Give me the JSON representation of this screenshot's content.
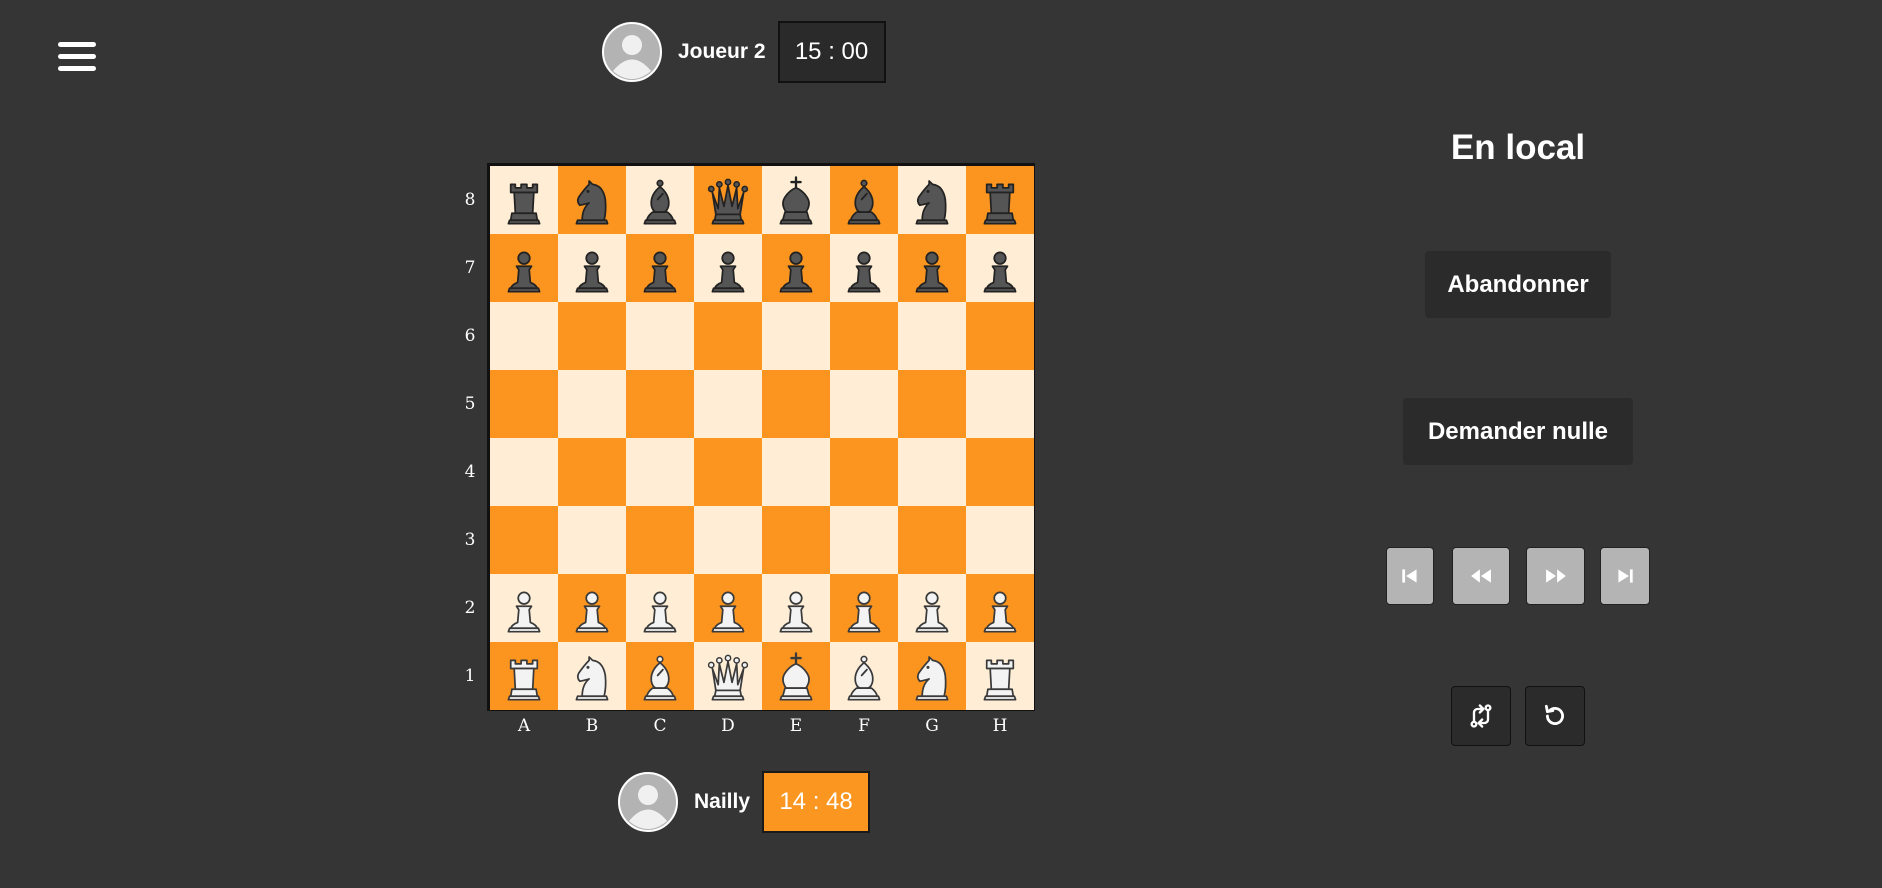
{
  "menu": {
    "icon": "hamburger-menu-icon"
  },
  "players": {
    "top": {
      "name": "Joueur 2",
      "clock": "15 : 00",
      "avatar_icon": "user-avatar-icon"
    },
    "bottom": {
      "name": "Nailly",
      "clock": "14 : 48",
      "avatar_icon": "user-avatar-icon"
    }
  },
  "board": {
    "ranks": [
      "8",
      "7",
      "6",
      "5",
      "4",
      "3",
      "2",
      "1"
    ],
    "files": [
      "A",
      "B",
      "C",
      "D",
      "E",
      "F",
      "G",
      "H"
    ],
    "position": [
      [
        "bR",
        "bN",
        "bB",
        "bQ",
        "bK",
        "bB",
        "bN",
        "bR"
      ],
      [
        "bP",
        "bP",
        "bP",
        "bP",
        "bP",
        "bP",
        "bP",
        "bP"
      ],
      [
        "",
        "",
        "",
        "",
        "",
        "",
        "",
        ""
      ],
      [
        "",
        "",
        "",
        "",
        "",
        "",
        "",
        ""
      ],
      [
        "",
        "",
        "",
        "",
        "",
        "",
        "",
        ""
      ],
      [
        "",
        "",
        "",
        "",
        "",
        "",
        "",
        ""
      ],
      [
        "wP",
        "wP",
        "wP",
        "wP",
        "wP",
        "wP",
        "wP",
        "wP"
      ],
      [
        "wR",
        "wN",
        "wB",
        "wQ",
        "wK",
        "wB",
        "wN",
        "wR"
      ]
    ],
    "colors": {
      "light": "#ffeed5",
      "dark": "#fb951f"
    }
  },
  "panel": {
    "mode_title": "En local",
    "resign_label": "Abandonner",
    "draw_label": "Demander nulle",
    "nav": [
      "first-move-icon",
      "previous-move-icon",
      "next-move-icon",
      "last-move-icon"
    ],
    "tools": [
      "flip-board-icon",
      "undo-icon"
    ]
  }
}
